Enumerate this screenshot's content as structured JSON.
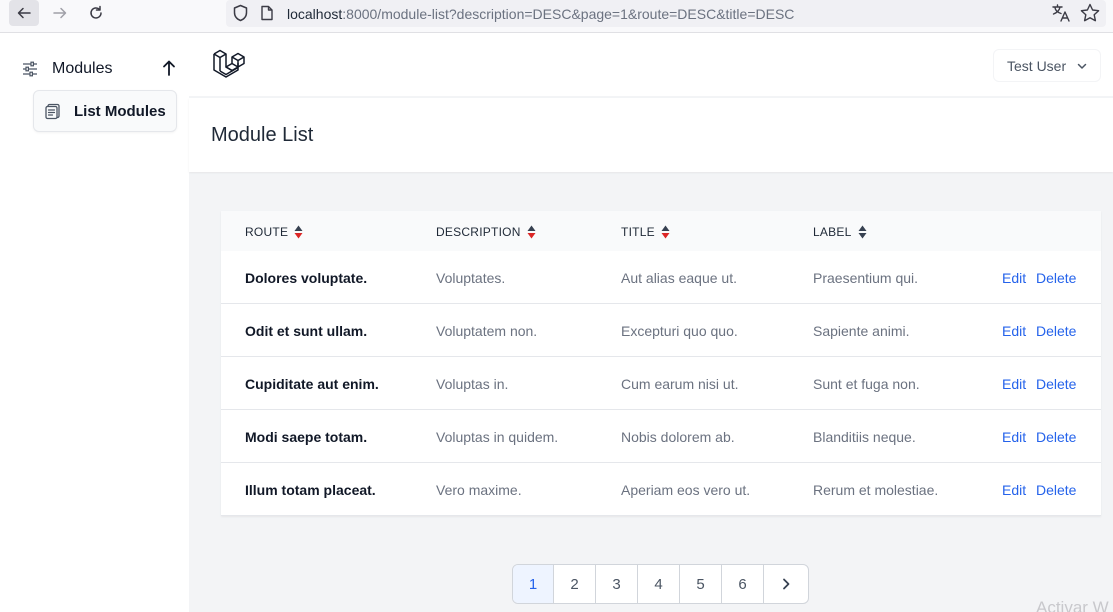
{
  "browser": {
    "url_host": "localhost",
    "url_rest": ":8000/module-list?description=DESC&page=1&route=DESC&title=DESC"
  },
  "sidebar": {
    "group_label": "Modules",
    "items": [
      {
        "label": "List Modules"
      }
    ]
  },
  "header": {
    "user_name": "Test User"
  },
  "page": {
    "title": "Module List"
  },
  "table": {
    "columns": [
      {
        "label": "ROUTE",
        "sort": "desc"
      },
      {
        "label": "DESCRIPTION",
        "sort": "desc"
      },
      {
        "label": "TITLE",
        "sort": "desc"
      },
      {
        "label": "LABEL",
        "sort": "none"
      }
    ],
    "edit_label": "Edit",
    "delete_label": "Delete",
    "rows": [
      {
        "route": "Dolores voluptate.",
        "description": "Voluptates.",
        "title": "Aut alias eaque ut.",
        "label": "Praesentium qui."
      },
      {
        "route": "Odit et sunt ullam.",
        "description": "Voluptatem non.",
        "title": "Excepturi quo quo.",
        "label": "Sapiente animi."
      },
      {
        "route": "Cupiditate aut enim.",
        "description": "Voluptas in.",
        "title": "Cum earum nisi ut.",
        "label": "Sunt et fuga non."
      },
      {
        "route": "Modi saepe totam.",
        "description": "Voluptas in quidem.",
        "title": "Nobis dolorem ab.",
        "label": "Blanditiis neque."
      },
      {
        "route": "Illum totam placeat.",
        "description": "Vero maxime.",
        "title": "Aperiam eos vero ut.",
        "label": "Rerum et molestiae."
      }
    ]
  },
  "pagination": {
    "pages": [
      "1",
      "2",
      "3",
      "4",
      "5",
      "6"
    ],
    "current": "1"
  },
  "watermark": "Activar W",
  "colors": {
    "accent": "#2563eb",
    "sort_active": "#dc2626",
    "sort_inactive": "#374151",
    "background": "#f3f4f6"
  }
}
